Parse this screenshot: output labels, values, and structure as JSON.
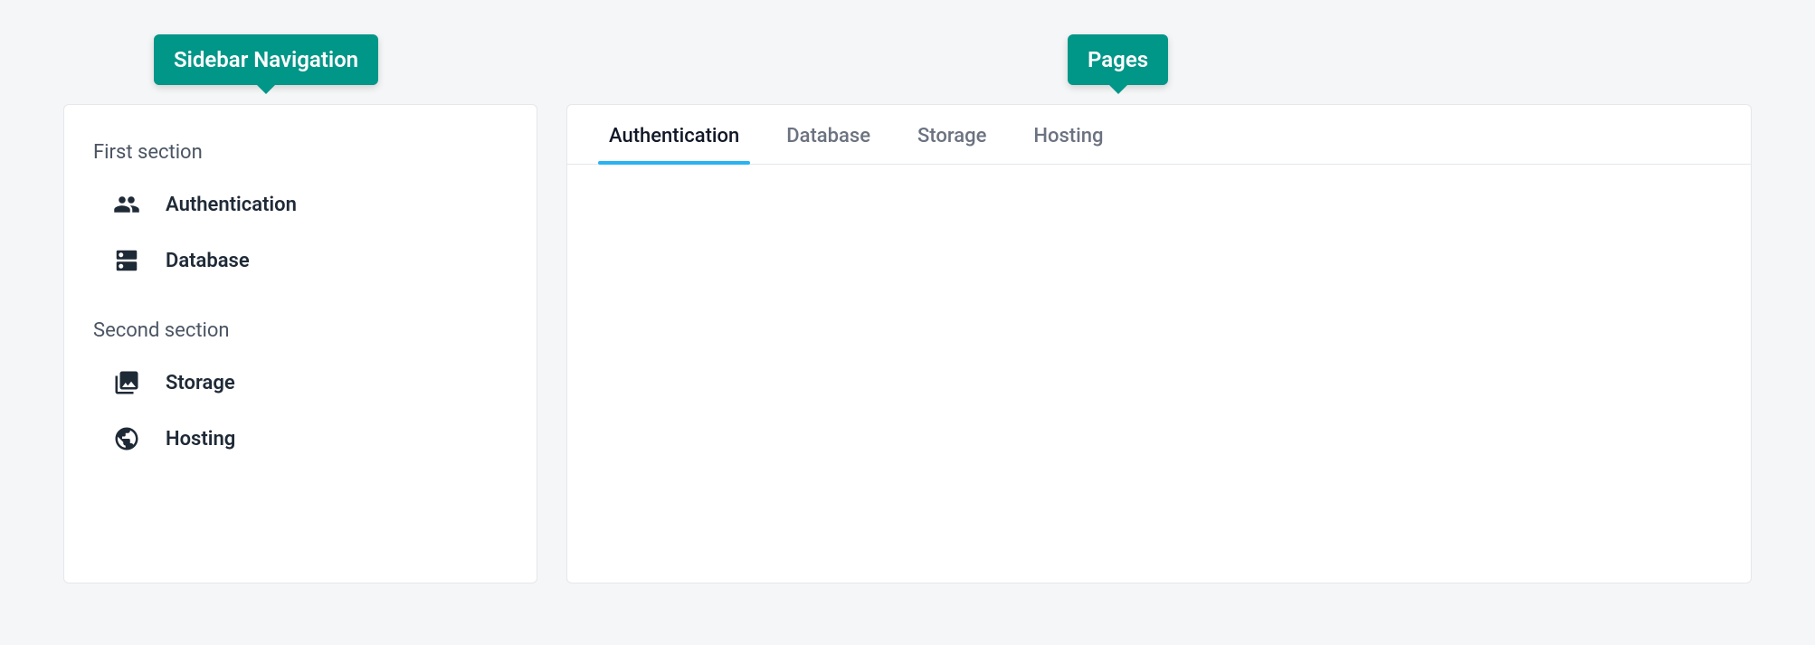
{
  "callouts": {
    "sidebar_label": "Sidebar Navigation",
    "pages_label": "Pages"
  },
  "sidebar": {
    "sections": [
      {
        "title": "First section",
        "items": [
          {
            "label": "Authentication",
            "icon": "people-icon"
          },
          {
            "label": "Database",
            "icon": "dns-icon"
          }
        ]
      },
      {
        "title": "Second section",
        "items": [
          {
            "label": "Storage",
            "icon": "photo-library-icon"
          },
          {
            "label": "Hosting",
            "icon": "public-icon"
          }
        ]
      }
    ]
  },
  "tabs": {
    "active_index": 0,
    "items": [
      {
        "label": "Authentication"
      },
      {
        "label": "Database"
      },
      {
        "label": "Storage"
      },
      {
        "label": "Hosting"
      }
    ]
  }
}
